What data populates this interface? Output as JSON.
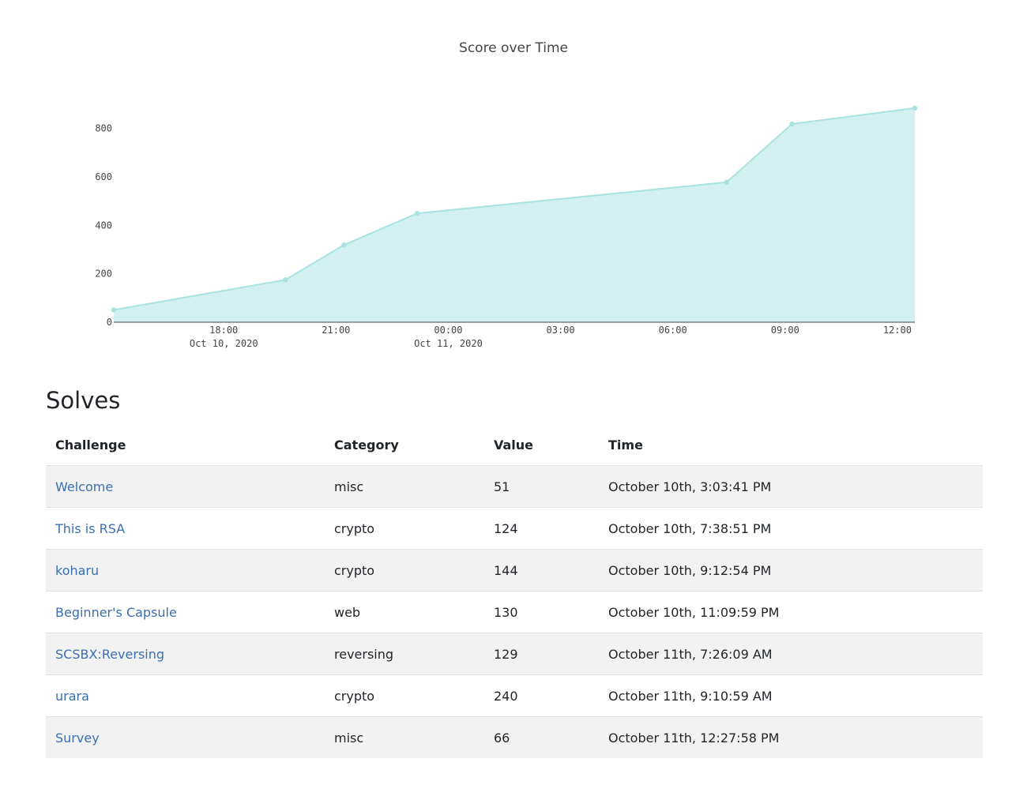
{
  "colors": {
    "area_fill": "#d2f0ef",
    "area_line": "#a8e3df",
    "link": "#3a6fb0",
    "row_stripe": "#f2f2f2"
  },
  "chart_data": {
    "type": "area",
    "title": "Score over Time",
    "xlabel": "",
    "ylabel": "",
    "ylim": [
      0,
      880
    ],
    "y_ticks": [
      "0",
      "200",
      "400",
      "600",
      "800"
    ],
    "x_ticks": [
      {
        "label": "18:00",
        "sublabel": "Oct 10, 2020",
        "t": "2020-10-10T18:00"
      },
      {
        "label": "21:00",
        "sublabel": "",
        "t": "2020-10-10T21:00"
      },
      {
        "label": "00:00",
        "sublabel": "Oct 11, 2020",
        "t": "2020-10-11T00:00"
      },
      {
        "label": "03:00",
        "sublabel": "",
        "t": "2020-10-11T03:00"
      },
      {
        "label": "06:00",
        "sublabel": "",
        "t": "2020-10-11T06:00"
      },
      {
        "label": "09:00",
        "sublabel": "",
        "t": "2020-10-11T09:00"
      },
      {
        "label": "12:00",
        "sublabel": "",
        "t": "2020-10-11T12:00"
      }
    ],
    "xlim": [
      "2020-10-10T15:03:41",
      "2020-10-11T12:27:58"
    ],
    "grid": false,
    "series": [
      {
        "points": [
          {
            "x": "2020-10-10T15:03:41",
            "y": 51
          },
          {
            "x": "2020-10-10T19:38:51",
            "y": 175
          },
          {
            "x": "2020-10-10T21:12:54",
            "y": 319
          },
          {
            "x": "2020-10-10T23:09:59",
            "y": 449
          },
          {
            "x": "2020-10-11T07:26:09",
            "y": 578
          },
          {
            "x": "2020-10-11T09:10:59",
            "y": 818
          },
          {
            "x": "2020-10-11T12:27:58",
            "y": 884
          }
        ]
      }
    ]
  },
  "solves": {
    "title": "Solves",
    "headers": {
      "challenge": "Challenge",
      "category": "Category",
      "value": "Value",
      "time": "Time"
    },
    "rows": [
      {
        "challenge": "Welcome",
        "category": "misc",
        "value": "51",
        "time": "October 10th, 3:03:41 PM"
      },
      {
        "challenge": "This is RSA",
        "category": "crypto",
        "value": "124",
        "time": "October 10th, 7:38:51 PM"
      },
      {
        "challenge": "koharu",
        "category": "crypto",
        "value": "144",
        "time": "October 10th, 9:12:54 PM"
      },
      {
        "challenge": "Beginner's Capsule",
        "category": "web",
        "value": "130",
        "time": "October 10th, 11:09:59 PM"
      },
      {
        "challenge": "SCSBX:Reversing",
        "category": "reversing",
        "value": "129",
        "time": "October 11th, 7:26:09 AM"
      },
      {
        "challenge": "urara",
        "category": "crypto",
        "value": "240",
        "time": "October 11th, 9:10:59 AM"
      },
      {
        "challenge": "Survey",
        "category": "misc",
        "value": "66",
        "time": "October 11th, 12:27:58 PM"
      }
    ]
  }
}
